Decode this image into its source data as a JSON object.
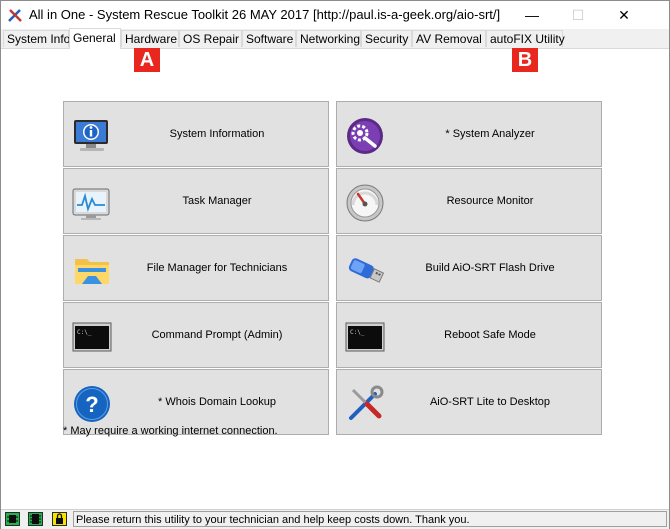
{
  "window": {
    "title": "All in One - System Rescue Toolkit 26 MAY 2017 [http://paul.is-a-geek.org/aio-srt/]",
    "min_symbol": "—",
    "max_symbol": "☐",
    "close_symbol": "✕"
  },
  "tabs": [
    {
      "label": "System Info",
      "active": false
    },
    {
      "label": "General",
      "active": true
    },
    {
      "label": "Hardware",
      "active": false
    },
    {
      "label": "OS Repair",
      "active": false
    },
    {
      "label": "Software",
      "active": false
    },
    {
      "label": "Networking",
      "active": false
    },
    {
      "label": "Security",
      "active": false
    },
    {
      "label": "AV Removal",
      "active": false
    },
    {
      "label": "autoFIX Utility",
      "active": false
    }
  ],
  "markers": {
    "a": "A",
    "b": "B"
  },
  "tools": [
    {
      "label": "System Information",
      "icon": "info-monitor-icon"
    },
    {
      "label": "* System Analyzer",
      "icon": "gear-wrench-icon"
    },
    {
      "label": "Task Manager",
      "icon": "task-monitor-icon"
    },
    {
      "label": "Resource Monitor",
      "icon": "gauge-icon"
    },
    {
      "label": "File Manager for Technicians",
      "icon": "folder-icon"
    },
    {
      "label": "Build AiO-SRT Flash Drive",
      "icon": "usb-drive-icon"
    },
    {
      "label": "Command Prompt (Admin)",
      "icon": "cmd-icon"
    },
    {
      "label": "Reboot Safe Mode",
      "icon": "cmd-icon"
    },
    {
      "label": "* Whois Domain Lookup",
      "icon": "question-icon"
    },
    {
      "label": "AiO-SRT Lite to Desktop",
      "icon": "tools-icon"
    }
  ],
  "note": "* May require a working internet connection.",
  "status": {
    "text": "Please return this utility to your technician and help keep costs down. Thank you."
  },
  "colors": {
    "marker": "#e8271e",
    "status_green": "#22b14c",
    "status_yellow": "#f4e400"
  }
}
